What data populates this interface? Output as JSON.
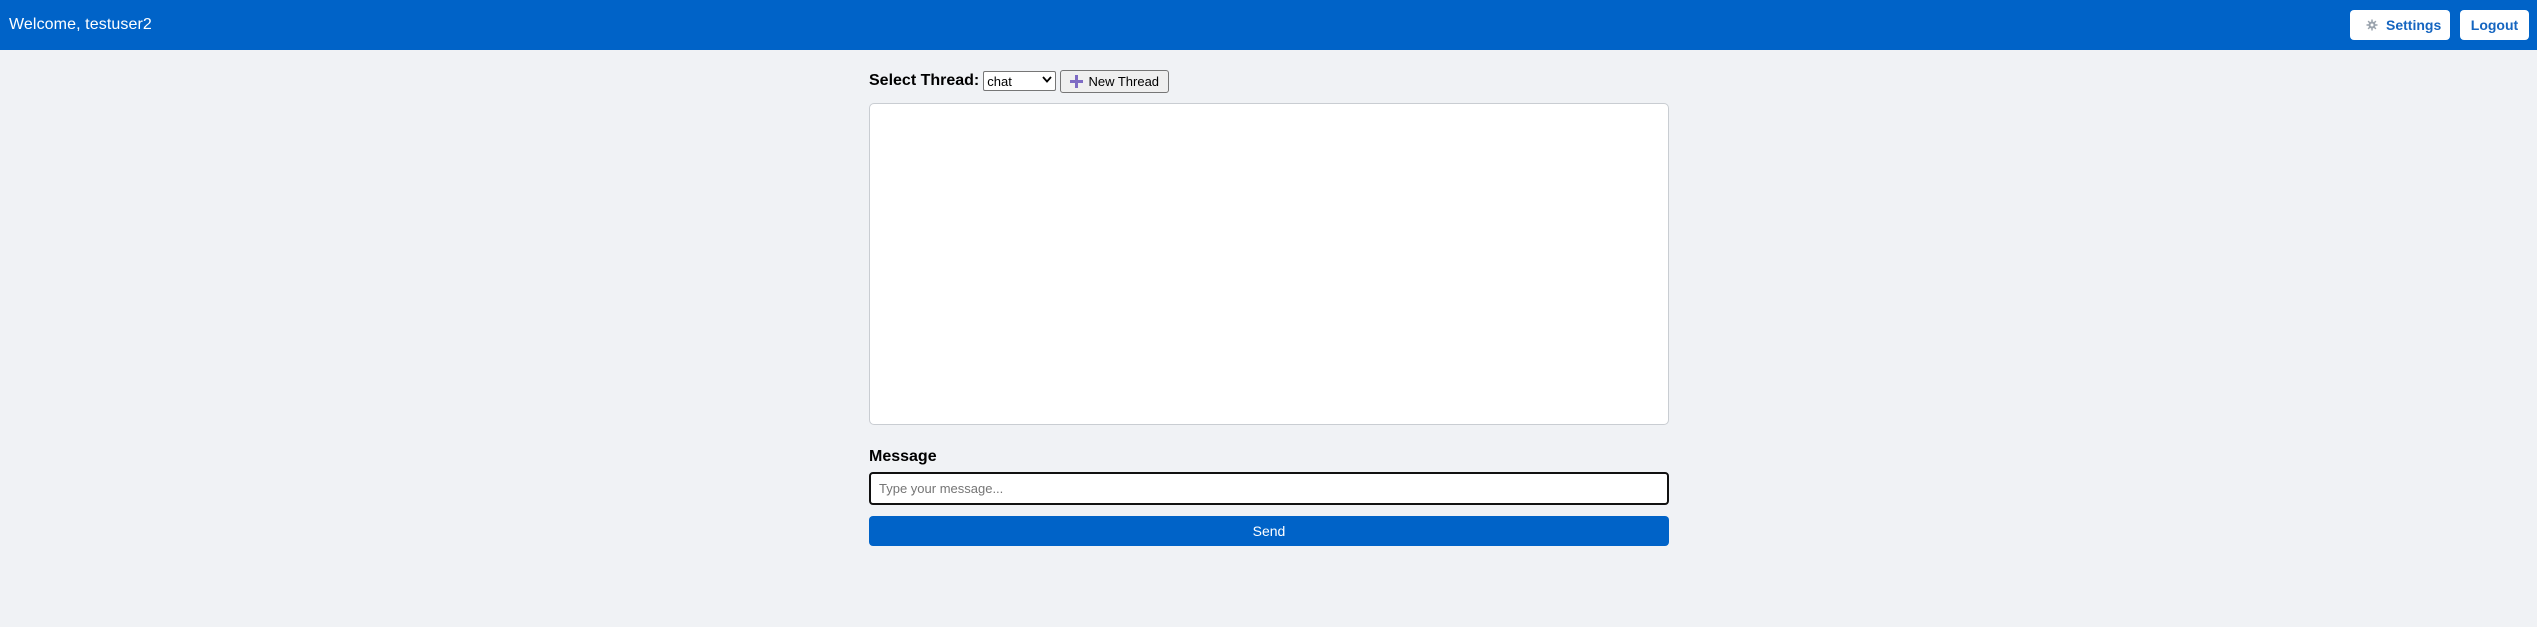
{
  "header": {
    "welcome_text": "Welcome, testuser2",
    "settings_label": "Settings",
    "logout_label": "Logout",
    "settings_icon": "gear-icon"
  },
  "thread": {
    "label": "Select Thread:",
    "selected": "chat",
    "new_thread_label": "New Thread",
    "new_thread_icon": "plus-icon"
  },
  "message": {
    "label": "Message",
    "value": "",
    "placeholder": "Type your message...",
    "send_label": "Send"
  },
  "colors": {
    "brand": "#0063c8",
    "background": "#f0f2f5",
    "button_text": "#1565c0"
  }
}
